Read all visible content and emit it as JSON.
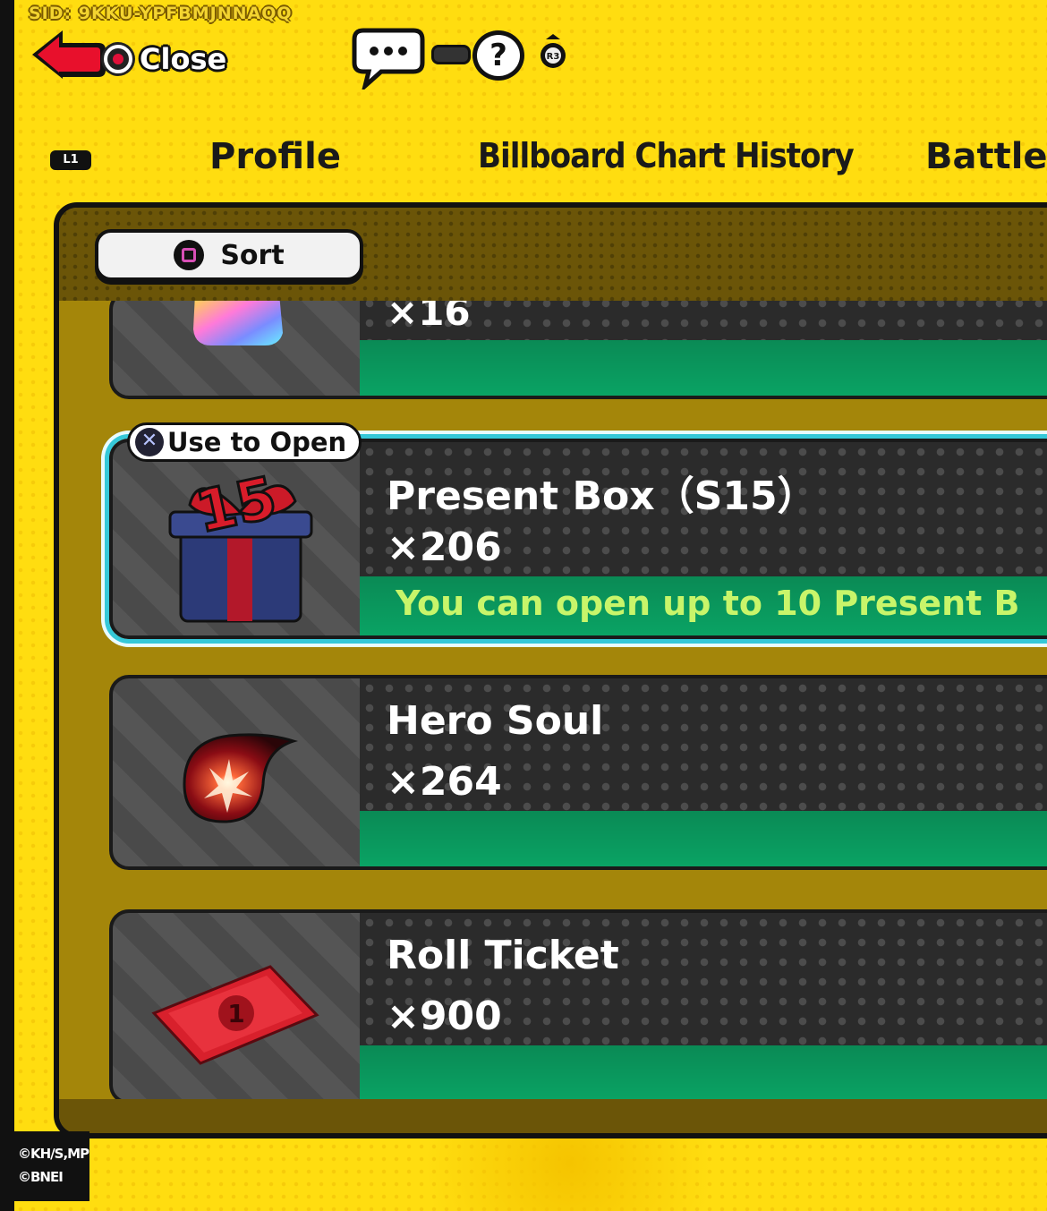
{
  "header": {
    "sid": "SID: 9KKU-YPFBMJNNAQQ",
    "close_label": "Close",
    "help_symbol": "?",
    "r3_label": "R3"
  },
  "tabs": {
    "l1_label": "L1",
    "items": [
      "Profile",
      "Billboard Chart History",
      "Battle"
    ]
  },
  "panel": {
    "sort_label": "Sort"
  },
  "items": [
    {
      "name": "",
      "quantity": "×16",
      "icon": "rainbow-gem-icon"
    },
    {
      "name": "Present Box（S15）",
      "quantity": "×206",
      "note": "You can open up to 10 Present B",
      "badge": "Use to Open",
      "icon": "present-box-icon",
      "selected": true
    },
    {
      "name": "Hero Soul",
      "quantity": "×264",
      "icon": "hero-soul-icon"
    },
    {
      "name": "Roll Ticket",
      "quantity": "×900",
      "icon": "roll-ticket-icon"
    }
  ],
  "footer": {
    "copyright_line1": "©KH/S,MP",
    "copyright_line2": "©BNEI"
  },
  "colors": {
    "background": "#ffdd10",
    "panel": "#a4860a",
    "accent_green": "#0aa364",
    "selection": "#35c8d8",
    "note_text": "#c8f56a"
  }
}
